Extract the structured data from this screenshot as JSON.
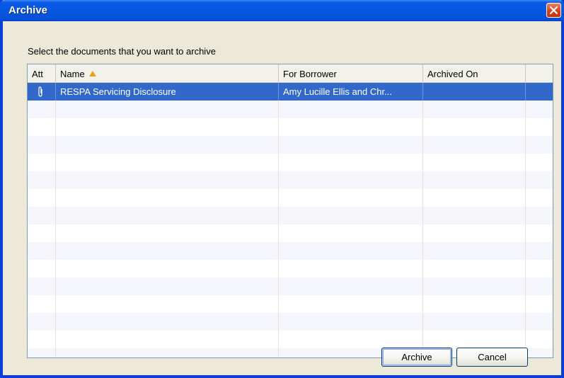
{
  "window": {
    "title": "Archive",
    "close_icon": "close-icon"
  },
  "instruction": "Select the documents that you want to archive",
  "table": {
    "columns": [
      {
        "label": "Att"
      },
      {
        "label": "Name",
        "sorted": "ascending",
        "sort_icon": "sort-up-triangle-icon"
      },
      {
        "label": "For Borrower"
      },
      {
        "label": "Archived On"
      },
      {
        "label": ""
      }
    ],
    "rows": [
      {
        "attachment_icon": "paperclip-icon",
        "name": "RESPA Servicing Disclosure",
        "borrower": "Amy Lucille Ellis and Chr...",
        "archived_on": "",
        "selected": true
      }
    ]
  },
  "buttons": {
    "archive": "Archive",
    "cancel": "Cancel"
  },
  "colors": {
    "title_bar": "#0a5ae8",
    "selection": "#3168c9",
    "close_button": "#d9401e",
    "sort_arrow": "#f0a020"
  }
}
